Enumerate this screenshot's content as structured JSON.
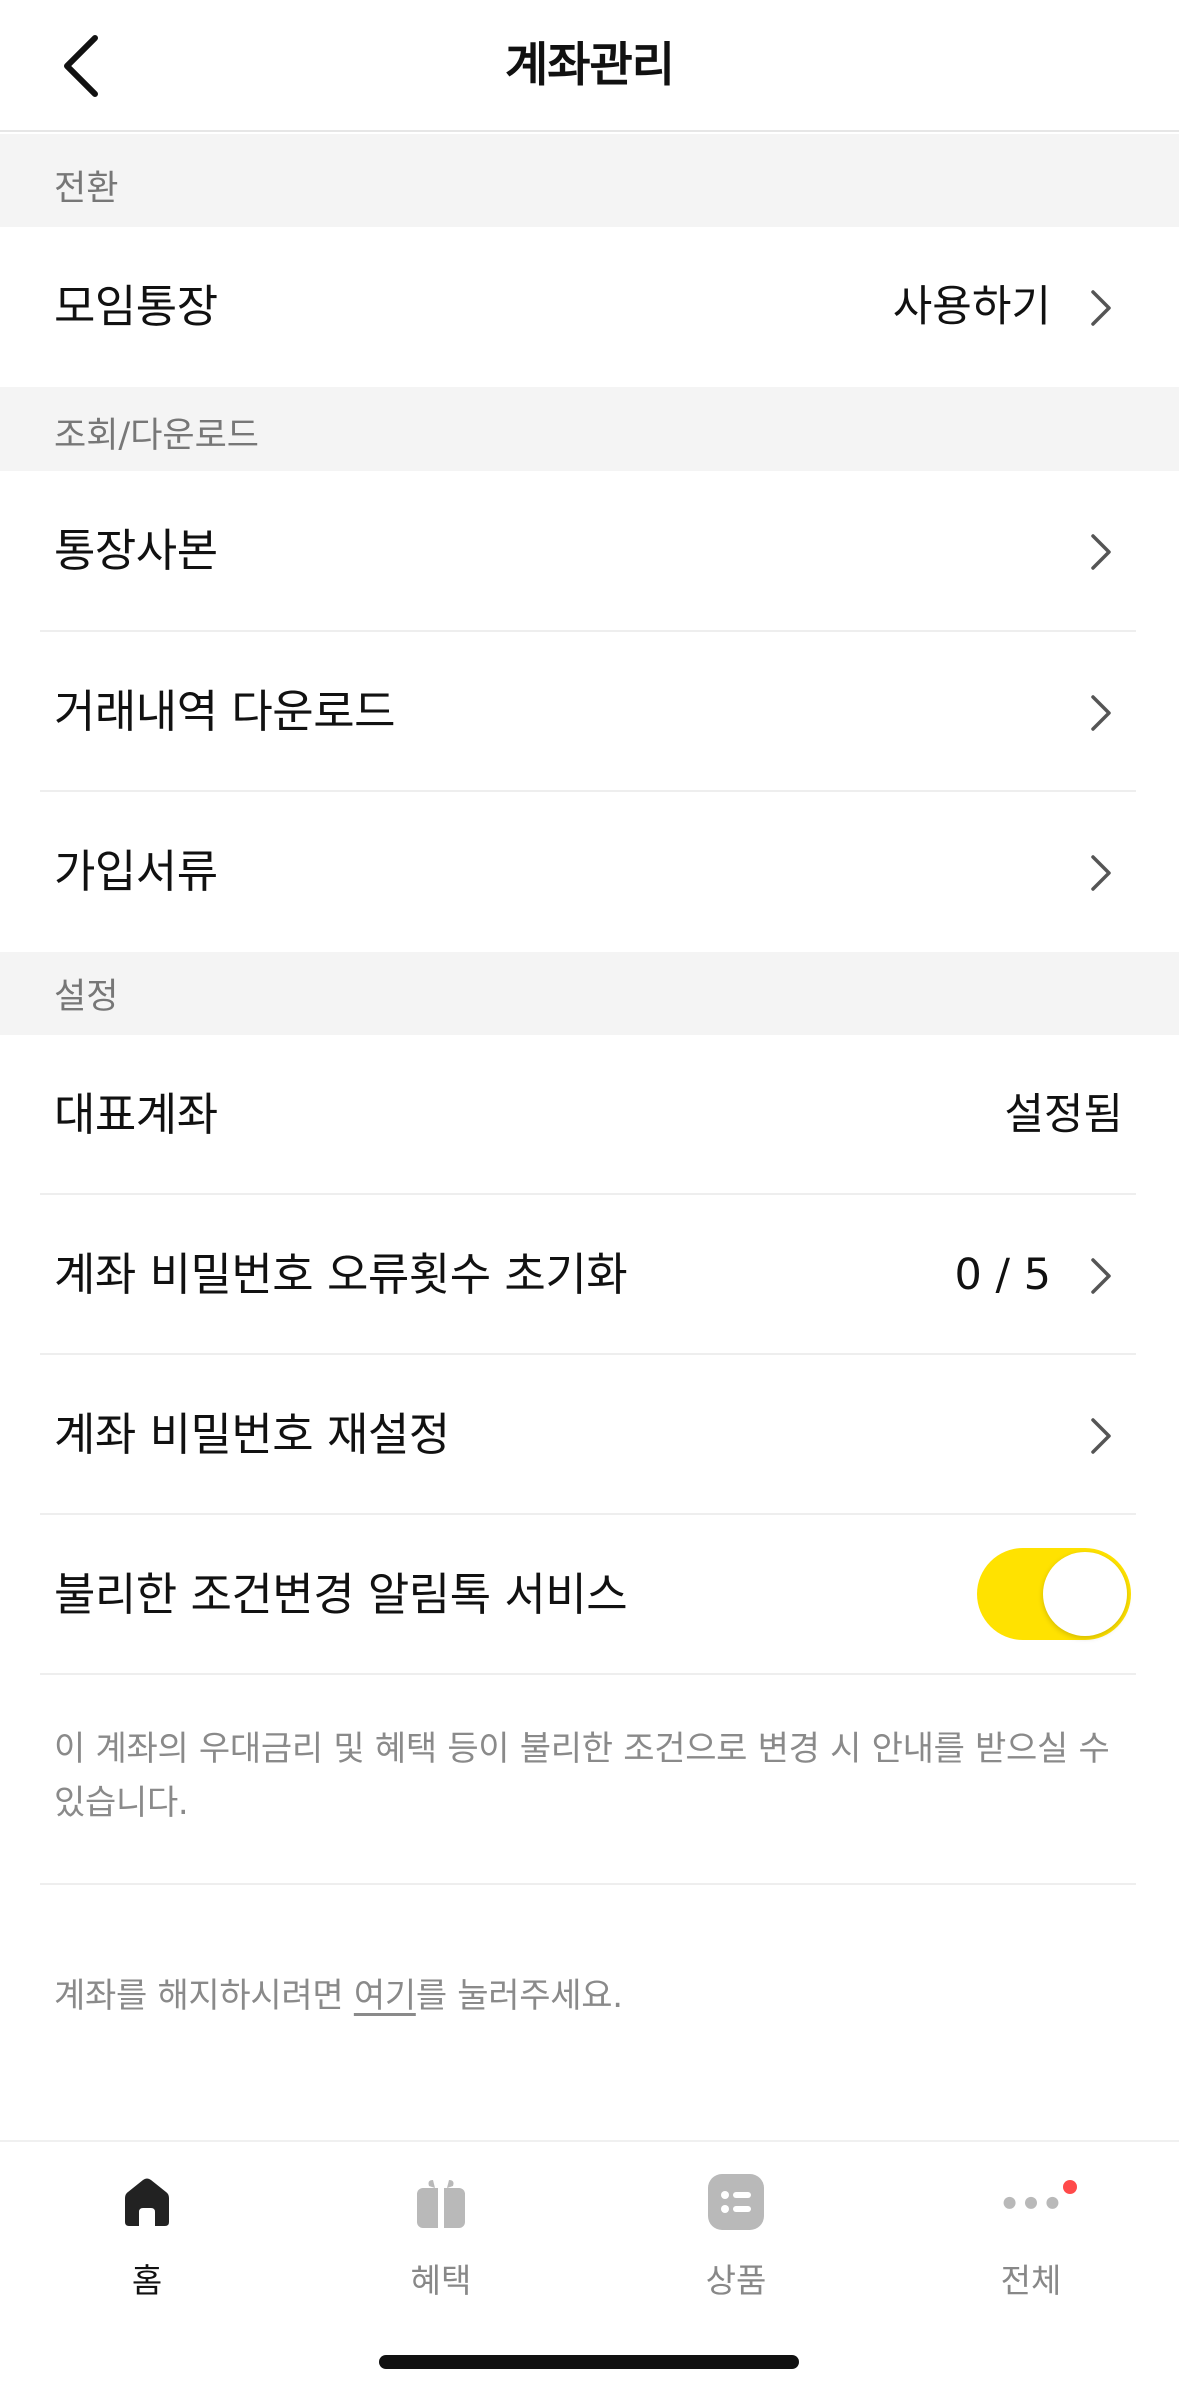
{
  "header": {
    "title": "계좌관리"
  },
  "sections": {
    "switch": "전환",
    "lookup": "조회/다운로드",
    "settings": "설정"
  },
  "rows": {
    "group_account": {
      "label": "모임통장",
      "value": "사용하기"
    },
    "bankbook_copy": {
      "label": "통장사본"
    },
    "tx_download": {
      "label": "거래내역 다운로드"
    },
    "signup_docs": {
      "label": "가입서류"
    },
    "main_account": {
      "label": "대표계좌",
      "value": "설정됨"
    },
    "pw_error_reset": {
      "label": "계좌 비밀번호 오류횟수 초기화",
      "value": "0 / 5"
    },
    "pw_reset": {
      "label": "계좌 비밀번호 재설정"
    },
    "alert_service": {
      "label": "불리한 조건변경 알림톡 서비스",
      "toggle_on": true
    }
  },
  "notice": "이 계좌의 우대금리 및 혜택 등이 불리한 조건으로 변경 시 안내를 받으실 수 있습니다.",
  "close_account": {
    "before": "계좌를 해지하시려면 ",
    "link": "여기",
    "after": "를 눌러주세요."
  },
  "tabbar": {
    "home": "홈",
    "benefits": "혜택",
    "products": "상품",
    "all": "전체"
  },
  "colors": {
    "accent": "#ffe200",
    "badge": "#ff4a4a",
    "section_bg": "#f4f4f4"
  }
}
